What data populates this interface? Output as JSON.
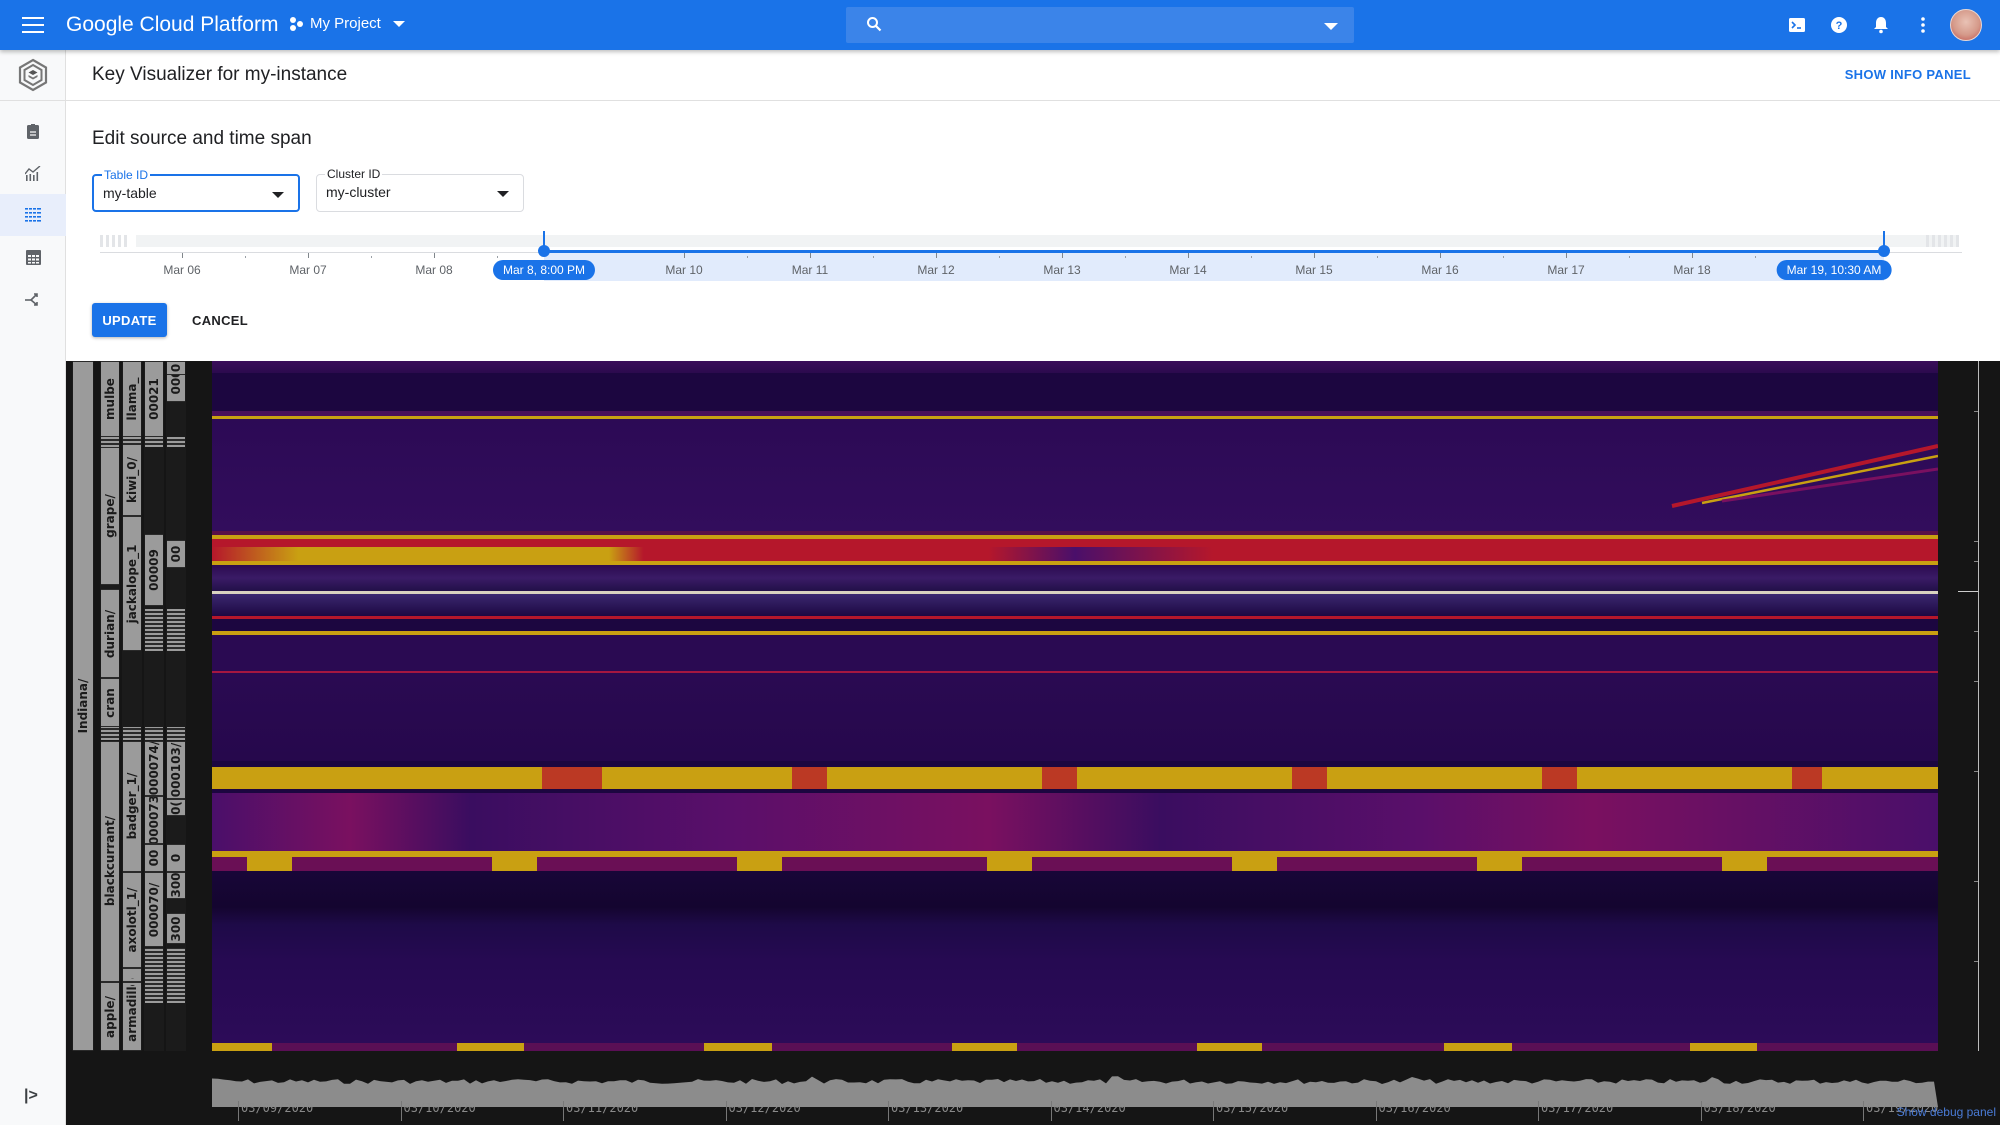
{
  "topbar": {
    "brand": "Google Cloud Platform",
    "project": "My Project",
    "search_placeholder": "",
    "icons": [
      "menu-icon",
      "project-icon",
      "search-icon",
      "cloud-shell-icon",
      "help-icon",
      "notifications-icon",
      "more-vert-icon",
      "avatar"
    ]
  },
  "sidebar": {
    "logo": "bigtable-logo-icon",
    "items": [
      {
        "name": "overview",
        "icon": "document-icon",
        "active": false
      },
      {
        "name": "monitoring",
        "icon": "chart-icon",
        "active": false
      },
      {
        "name": "key-visualizer",
        "icon": "heatmap-icon",
        "active": true
      },
      {
        "name": "tables",
        "icon": "table-icon",
        "active": false
      },
      {
        "name": "replication",
        "icon": "replication-icon",
        "active": false
      }
    ],
    "collapse_label": "|>"
  },
  "header": {
    "title": "Key Visualizer for my-instance",
    "info_button": "SHOW INFO PANEL"
  },
  "edit": {
    "title": "Edit source and time span",
    "table_field": {
      "label": "Table ID",
      "value": "my-table"
    },
    "cluster_field": {
      "label": "Cluster ID",
      "value": "my-cluster"
    },
    "timeline": {
      "labels": [
        "Mar 06",
        "Mar 07",
        "Mar 08",
        "Mar 10",
        "Mar 11",
        "Mar 12",
        "Mar 13",
        "Mar 14",
        "Mar 15",
        "Mar 16",
        "Mar 17",
        "Mar 18"
      ],
      "start_chip": "Mar 8, 8:00 PM",
      "end_chip": "Mar 19, 10:30 AM"
    },
    "update_button": "UPDATE",
    "cancel_button": "CANCEL"
  },
  "visualizer": {
    "key_columns": [
      [
        {
          "label": "Indiana/",
          "from": 0,
          "to": 1
        }
      ],
      [
        {
          "label": "mulbe",
          "from": 0,
          "to": 0.11
        },
        {
          "label": "grape/",
          "from": 0.125,
          "to": 0.325
        },
        {
          "label": "durian/",
          "from": 0.33,
          "to": 0.46
        },
        {
          "label": "cran",
          "from": 0.46,
          "to": 0.53
        },
        {
          "label": "blackcurrant/",
          "from": 0.55,
          "to": 0.9
        },
        {
          "label": "apple/",
          "from": 0.9,
          "to": 1
        }
      ],
      [
        {
          "label": "llama_",
          "from": 0,
          "to": 0.11
        },
        {
          "label": "kiwi_0/",
          "from": 0.12,
          "to": 0.225
        },
        {
          "label": "jackalope_1",
          "from": 0.225,
          "to": 0.42
        },
        {
          "label": "badger_1/",
          "from": 0.55,
          "to": 0.74
        },
        {
          "label": "axolotl_1/",
          "from": 0.74,
          "to": 0.88
        },
        {
          "label": "armadillo",
          "from": 0.88,
          "to": 1
        }
      ],
      [
        {
          "label": "00021",
          "from": 0,
          "to": 0.11
        },
        {
          "label": "00009",
          "from": 0.25,
          "to": 0.355
        },
        {
          "label": "000074/",
          "from": 0.55,
          "to": 0.63
        },
        {
          "label": "000073",
          "from": 0.63,
          "to": 0.7
        },
        {
          "label": "00",
          "from": 0.7,
          "to": 0.74
        },
        {
          "label": "000070/",
          "from": 0.74,
          "to": 0.85
        }
      ],
      [
        {
          "label": "000",
          "from": 0,
          "to": 0.06
        },
        {
          "label": "0",
          "from": 0,
          "to": 0.02
        },
        {
          "label": "00",
          "from": 0.26,
          "to": 0.3
        },
        {
          "label": "000103/",
          "from": 0.55,
          "to": 0.635
        },
        {
          "label": "0(",
          "from": 0.635,
          "to": 0.66
        },
        {
          "label": "0",
          "from": 0.7,
          "to": 0.74
        },
        {
          "label": "300",
          "from": 0.74,
          "to": 0.78
        },
        {
          "label": "300",
          "from": 0.8,
          "to": 0.845
        }
      ]
    ],
    "x_labels": [
      "03/09/2020",
      "03/10/2020",
      "03/11/2020",
      "03/12/2020",
      "03/13/2020",
      "03/14/2020",
      "03/15/2020",
      "03/16/2020",
      "03/17/2020",
      "03/18/2020",
      "03/19/2020"
    ],
    "debug_link": "Show debug panel",
    "colors": {
      "low": "#1c0640",
      "mid": "#4a0f6a",
      "high": "#b5172b",
      "hot": "#c9a012",
      "brand": "#1a73e8"
    }
  }
}
